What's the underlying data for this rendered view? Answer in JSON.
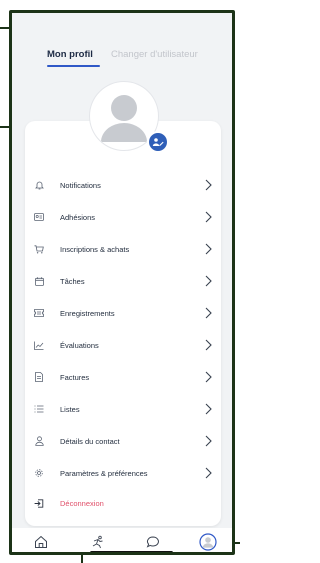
{
  "tabs": [
    {
      "label": "Mon profil",
      "active": true
    },
    {
      "label": "Changer d'utilisateur",
      "active": false
    }
  ],
  "menu": [
    {
      "label": "Notifications",
      "icon": "bell-icon"
    },
    {
      "label": "Adhésions",
      "icon": "id-card-icon"
    },
    {
      "label": "Inscriptions & achats",
      "icon": "cart-icon"
    },
    {
      "label": "Tâches",
      "icon": "calendar-icon"
    },
    {
      "label": "Enregistrements",
      "icon": "ticket-icon"
    },
    {
      "label": "Évaluations",
      "icon": "chart-icon"
    },
    {
      "label": "Factures",
      "icon": "invoice-icon"
    },
    {
      "label": "Listes",
      "icon": "list-icon"
    },
    {
      "label": "Détails du contact",
      "icon": "person-icon"
    },
    {
      "label": "Paramètres & préférences",
      "icon": "gear-icon"
    }
  ],
  "logout": {
    "label": "Déconnexion",
    "icon": "logout-icon"
  },
  "bottom_nav": [
    {
      "name": "home",
      "icon": "home-icon"
    },
    {
      "name": "activities",
      "icon": "figure-icon"
    },
    {
      "name": "messages",
      "icon": "chat-icon"
    },
    {
      "name": "profile",
      "icon": "avatar-icon",
      "active": true
    }
  ],
  "colors": {
    "accent": "#2f58c7",
    "logout": "#e0506a",
    "frame": "#1c3317"
  }
}
